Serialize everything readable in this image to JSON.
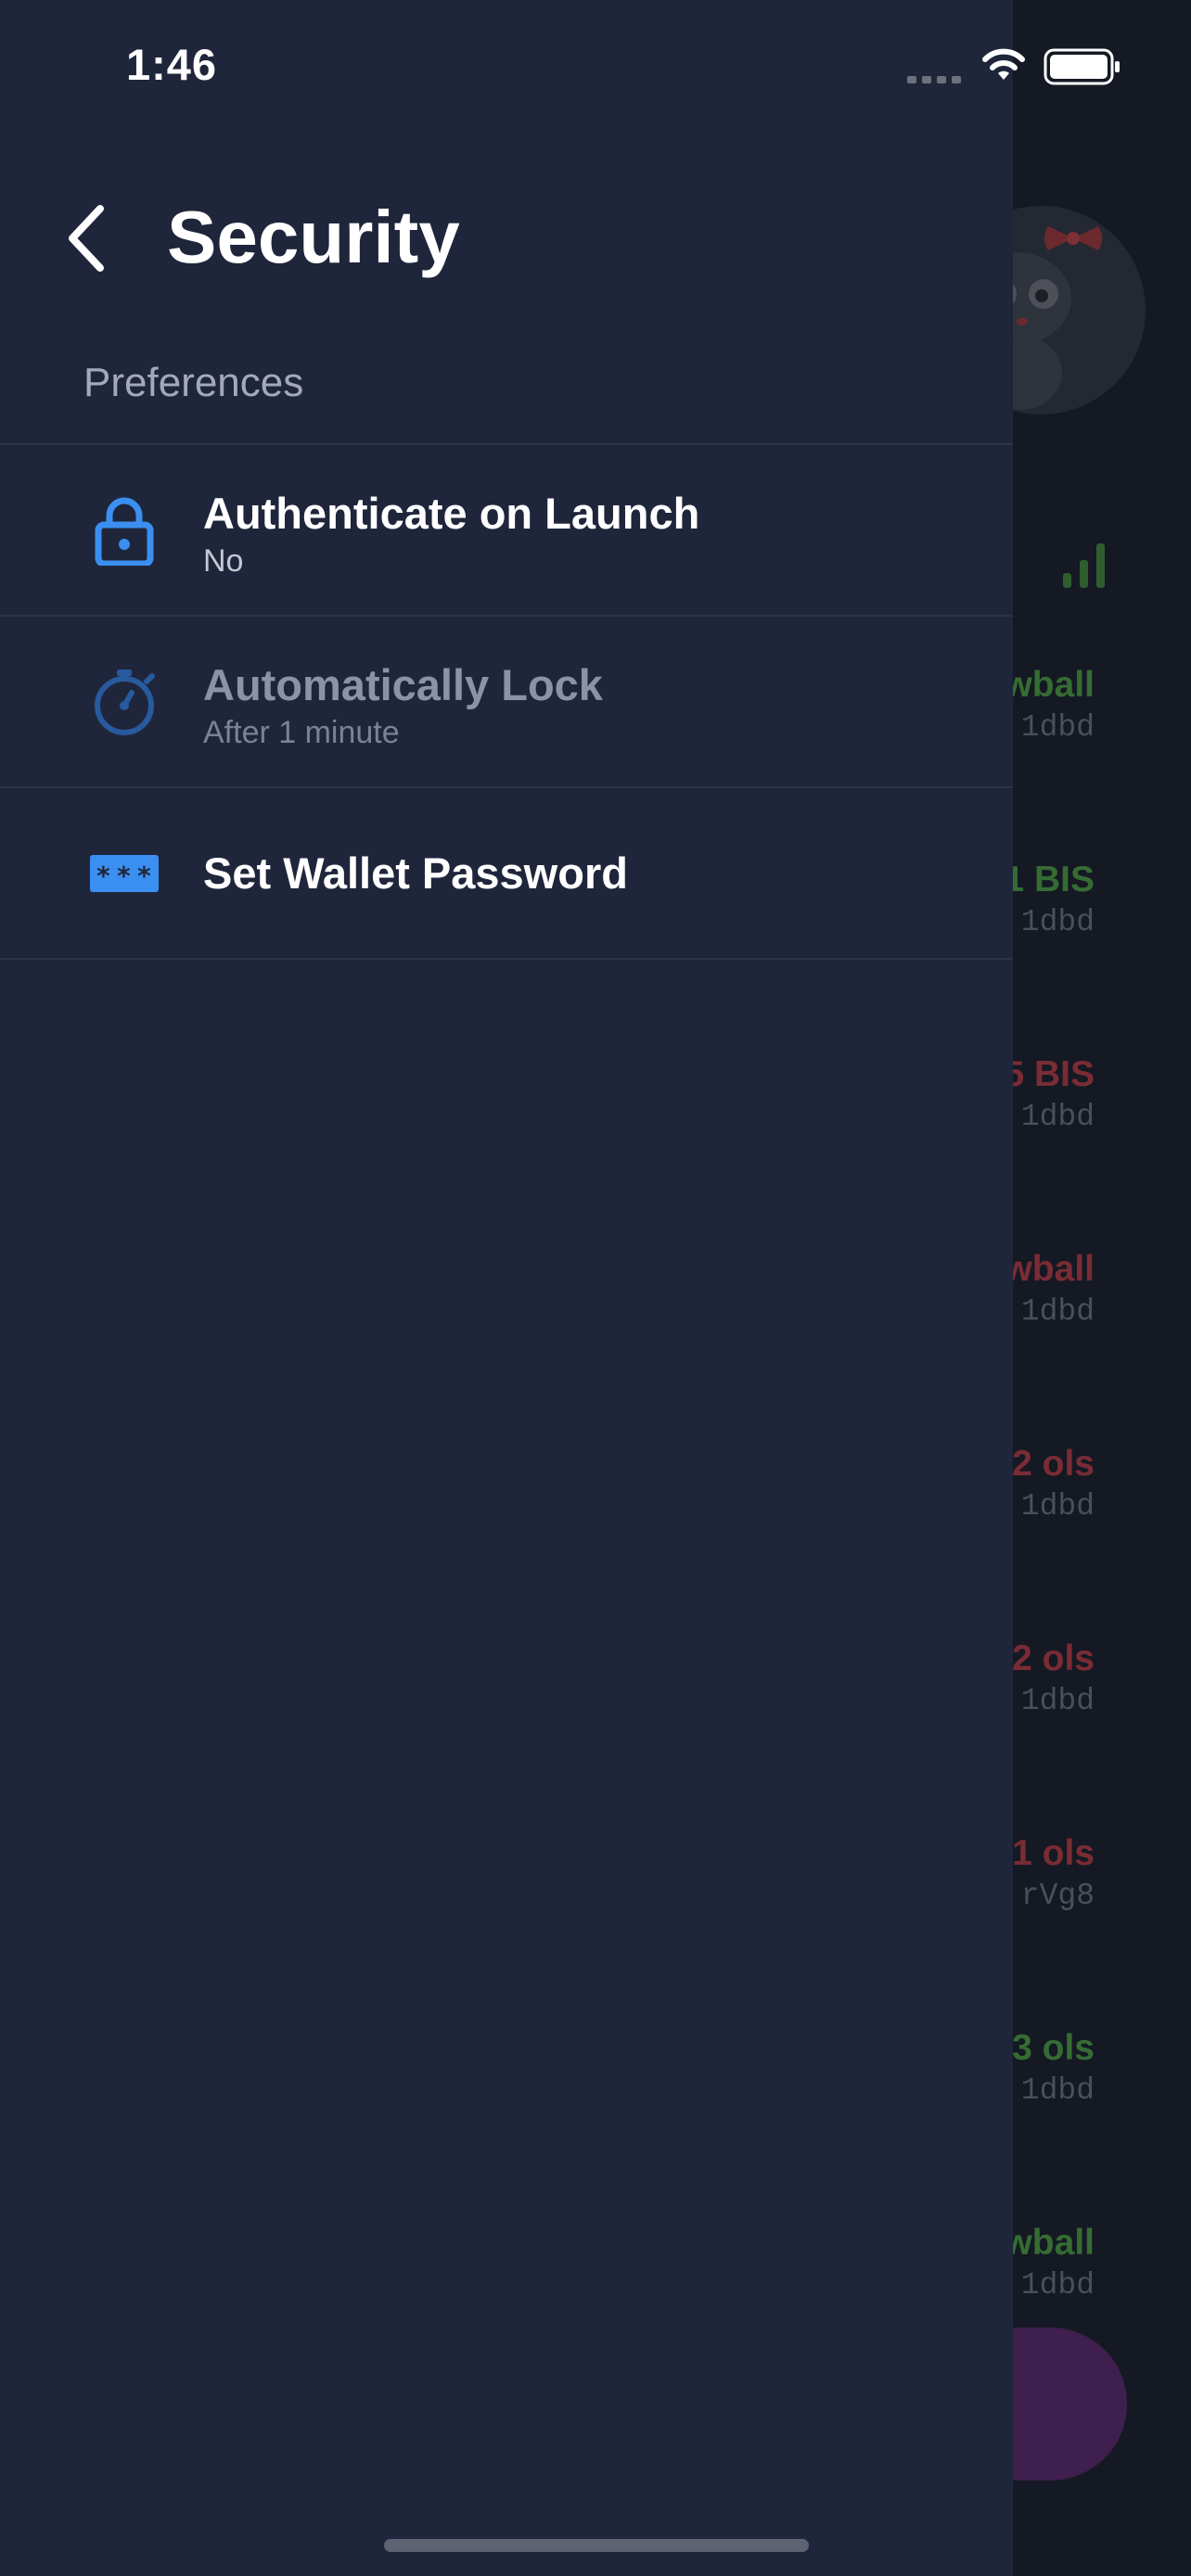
{
  "status_bar": {
    "time": "1:46"
  },
  "header": {
    "title": "Security",
    "back_icon": "chevron-left-icon"
  },
  "preferences": {
    "section_label": "Preferences",
    "items": [
      {
        "icon": "lock-icon",
        "title": "Authenticate on Launch",
        "subtitle": "No",
        "enabled": true
      },
      {
        "icon": "timer-icon",
        "title": "Automatically Lock",
        "subtitle": "After 1 minute",
        "enabled": false
      },
      {
        "icon": "password-icon",
        "title": "Set Wallet Password",
        "enabled": true
      }
    ]
  },
  "background": {
    "transactions": [
      {
        "amount": "wball",
        "address": "1dbd",
        "type": "received"
      },
      {
        "amount": "1 BIS",
        "address": "1dbd",
        "type": "received"
      },
      {
        "amount": "5 BIS",
        "address": "1dbd",
        "type": "sent"
      },
      {
        "amount": "wball",
        "address": "1dbd",
        "type": "sent"
      },
      {
        "amount": "2 ols",
        "address": "1dbd",
        "type": "sent"
      },
      {
        "amount": "2 ols",
        "address": "1dbd",
        "type": "sent"
      },
      {
        "amount": "1 ols",
        "address": "rVg8",
        "type": "sent"
      },
      {
        "amount": "3 ols",
        "address": "1dbd",
        "type": "received"
      },
      {
        "amount": "wball",
        "address": "1dbd",
        "type": "received"
      }
    ]
  },
  "colors": {
    "drawer_bg": "#1f263b",
    "accent_blue": "#3b8ff0",
    "received_green": "#356c33",
    "sent_red": "#7a2c35",
    "divider": "#2c3449"
  }
}
